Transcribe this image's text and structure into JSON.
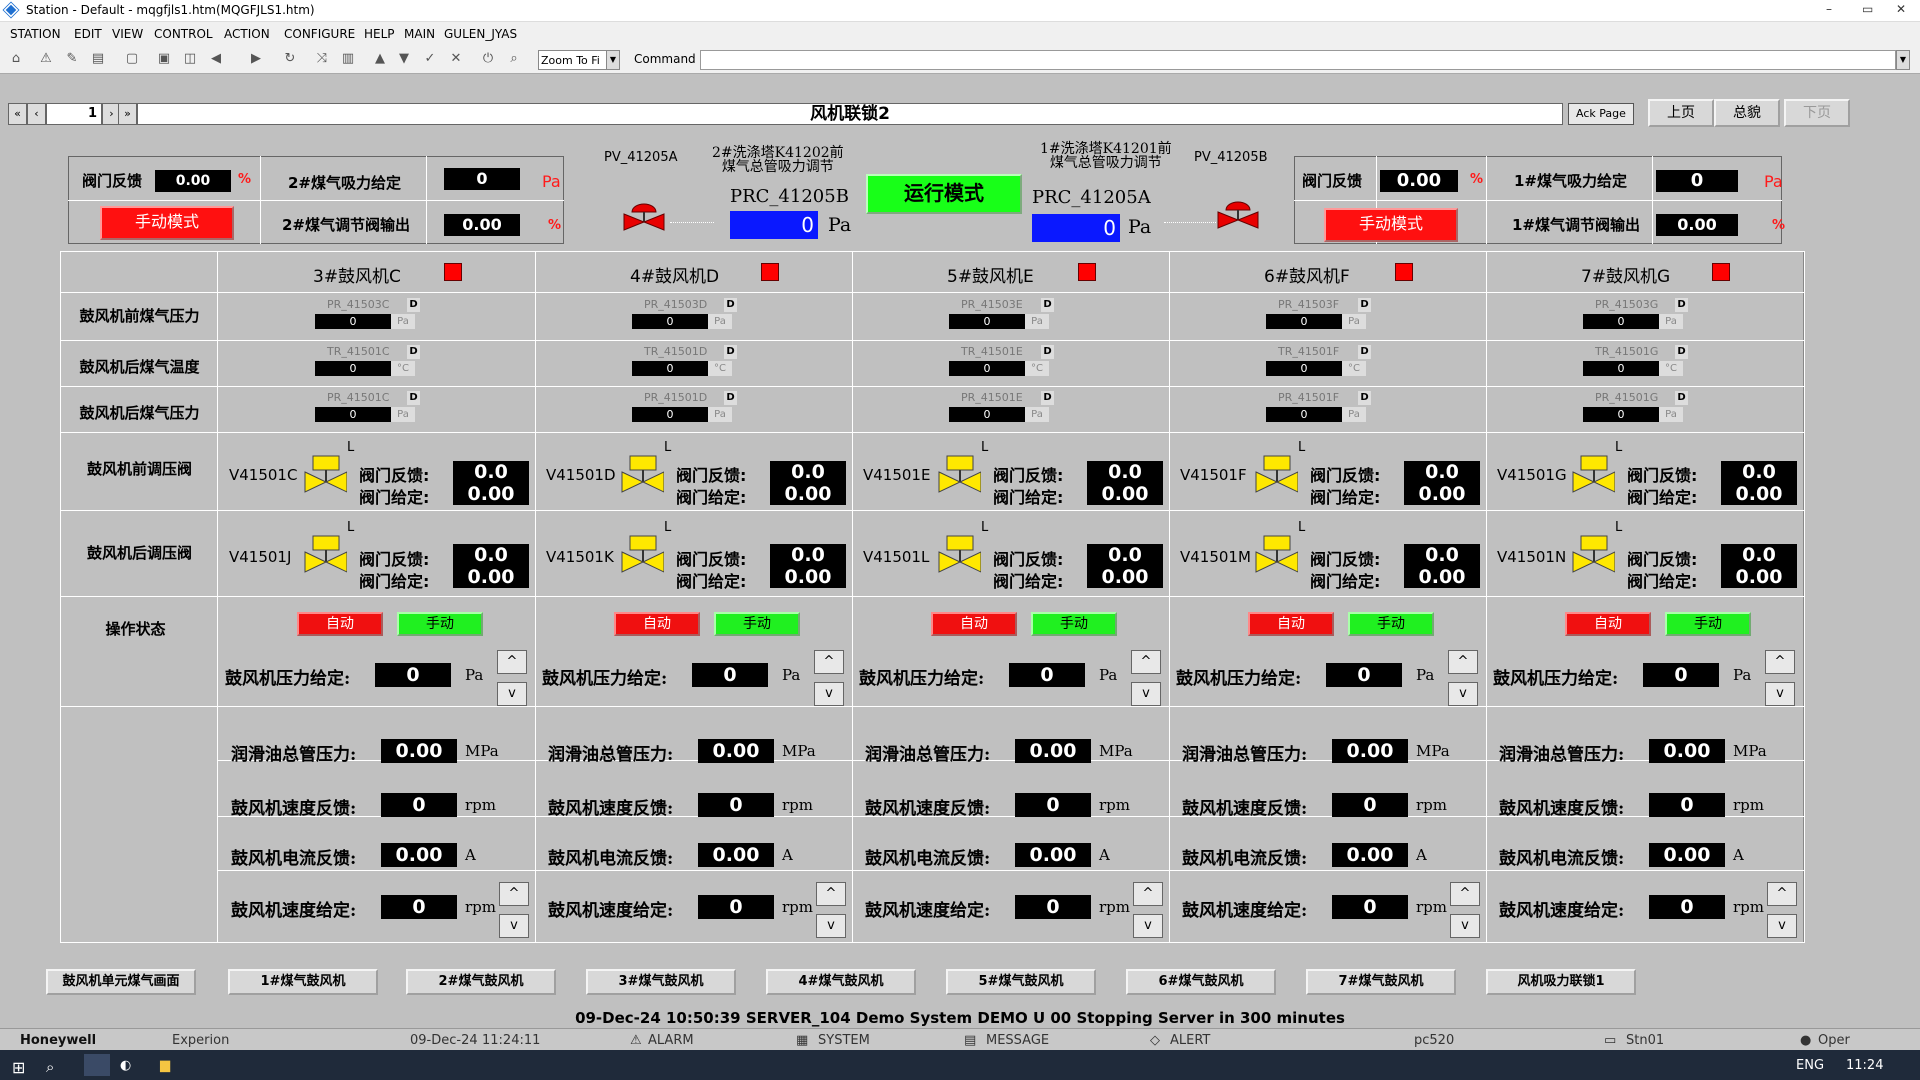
{
  "window": {
    "title": "Station - Default - mqgfjls1.htm(MQGFJLS1.htm)",
    "min": "–",
    "max": "▭",
    "close": "✕"
  },
  "menu": [
    "STATION",
    "EDIT",
    "VIEW",
    "CONTROL",
    "ACTION",
    "CONFIGURE",
    "HELP",
    "MAIN",
    "GULEN_JYAS"
  ],
  "toolbar": {
    "zoom": "Zoom To Fi",
    "command_label": "Command"
  },
  "page": {
    "number": "1",
    "title": "风机联锁2",
    "ack": "Ack Page",
    "prev": "上页",
    "overview": "总貌",
    "next": "下页"
  },
  "left_panel": {
    "valve_fb_label": "阀门反馈",
    "valve_fb_value": "0.00",
    "pct": "%",
    "setpoint_label": "2#煤气吸力给定",
    "setpoint_value": "0",
    "pa": "Pa",
    "output_label": "2#煤气调节阀输出",
    "output_value": "0.00",
    "mode_button": "手动模式"
  },
  "right_panel": {
    "valve_fb_label": "阀门反馈",
    "valve_fb_value": "0.00",
    "pct": "%",
    "setpoint_label": "1#煤气吸力给定",
    "setpoint_value": "0",
    "pa": "Pa",
    "output_label": "1#煤气调节阀输出",
    "output_value": "0.00",
    "mode_button": "手动模式"
  },
  "center": {
    "pv_a": "PV_41205A",
    "pv_b": "PV_41205B",
    "desc_b1": "2#洗涤塔K41202前",
    "desc_b2": "煤气总管吸力调节",
    "prc_b": "PRC_41205B",
    "prc_b_value": "0",
    "desc_a1": "1#洗涤塔K41201前",
    "desc_a2": "煤气总管吸力调节",
    "prc_a": "PRC_41205A",
    "prc_a_value": "0",
    "unit": "Pa",
    "run_mode": "运行模式"
  },
  "rows": [
    "鼓风机前煤气压力",
    "鼓风机后煤气温度",
    "鼓风机后煤气压力",
    "鼓风机前调压阀",
    "鼓风机后调压阀",
    "操作状态"
  ],
  "common": {
    "fb": "阀门反馈:",
    "sp": "阀门给定:",
    "auto": "自动",
    "manual": "手动",
    "pres_sp": "鼓风机压力给定:",
    "lube": "润滑油总管压力:",
    "speed_fb": "鼓风机速度反馈:",
    "cur_fb": "鼓风机电流反馈:",
    "speed_sp": "鼓风机速度给定:",
    "mpa": "MPa",
    "rpm": "rpm",
    "amp": "A",
    "pa": "Pa",
    "up": "^",
    "down": "v",
    "L": "L",
    "D": "D",
    "degc": "°C"
  },
  "fans": [
    {
      "name": "3#鼓风机C",
      "pr1": "PR_41503C",
      "tr": "TR_41501C",
      "pr2": "PR_41501C",
      "pv": "0",
      "vfront": "V41501C",
      "vback": "V41501J",
      "ffb": "0.0",
      "fsp": "0.00",
      "bfb": "0.0",
      "bsp": "0.00",
      "psp": "0",
      "lube": "0.00",
      "spd": "0",
      "cur": "0.00",
      "spdsp": "0"
    },
    {
      "name": "4#鼓风机D",
      "pr1": "PR_41503D",
      "tr": "TR_41501D",
      "pr2": "PR_41501D",
      "pv": "0",
      "vfront": "V41501D",
      "vback": "V41501K",
      "ffb": "0.0",
      "fsp": "0.00",
      "bfb": "0.0",
      "bsp": "0.00",
      "psp": "0",
      "lube": "0.00",
      "spd": "0",
      "cur": "0.00",
      "spdsp": "0"
    },
    {
      "name": "5#鼓风机E",
      "pr1": "PR_41503E",
      "tr": "TR_41501E",
      "pr2": "PR_41501E",
      "pv": "0",
      "vfront": "V41501E",
      "vback": "V41501L",
      "ffb": "0.0",
      "fsp": "0.00",
      "bfb": "0.0",
      "bsp": "0.00",
      "psp": "0",
      "lube": "0.00",
      "spd": "0",
      "cur": "0.00",
      "spdsp": "0"
    },
    {
      "name": "6#鼓风机F",
      "pr1": "PR_41503F",
      "tr": "TR_41501F",
      "pr2": "PR_41501F",
      "pv": "0",
      "vfront": "V41501F",
      "vback": "V41501M",
      "ffb": "0.0",
      "fsp": "0.00",
      "bfb": "0.0",
      "bsp": "0.00",
      "psp": "0",
      "lube": "0.00",
      "spd": "0",
      "cur": "0.00",
      "spdsp": "0"
    },
    {
      "name": "7#鼓风机G",
      "pr1": "PR_41503G",
      "tr": "TR_41501G",
      "pr2": "PR_41501G",
      "pv": "0",
      "vfront": "V41501G",
      "vback": "V41501N",
      "ffb": "0.0",
      "fsp": "0.00",
      "bfb": "0.0",
      "bsp": "0.00",
      "psp": "0",
      "lube": "0.00",
      "spd": "0",
      "cur": "0.00",
      "spdsp": "0"
    }
  ],
  "nav_buttons": [
    "鼓风机单元煤气画面",
    "1#煤气鼓风机",
    "2#煤气鼓风机",
    "3#煤气鼓风机",
    "4#煤气鼓风机",
    "5#煤气鼓风机",
    "6#煤气鼓风机",
    "7#煤气鼓风机",
    "风机吸力联锁1"
  ],
  "status": {
    "message": "09-Dec-24   10:50:39   SERVER_104   Demo System   DEMO   U 00 Stopping Server in 300 minutes",
    "brand": "Honeywell",
    "product": "Experion",
    "date": "09-Dec-24",
    "time": "11:24:11",
    "alarm": "ALARM",
    "system": "SYSTEM",
    "message_lbl": "MESSAGE",
    "alert": "ALERT",
    "host": "pc520",
    "station": "Stn01",
    "user": "Oper"
  },
  "taskbar": {
    "lang": "ENG",
    "clock": "11:24"
  },
  "colors": {
    "bg": "#c0c0c0",
    "red": "#ff1010",
    "green": "#18ff18",
    "blue": "#0a18ff",
    "yellow": "#ffe800"
  }
}
